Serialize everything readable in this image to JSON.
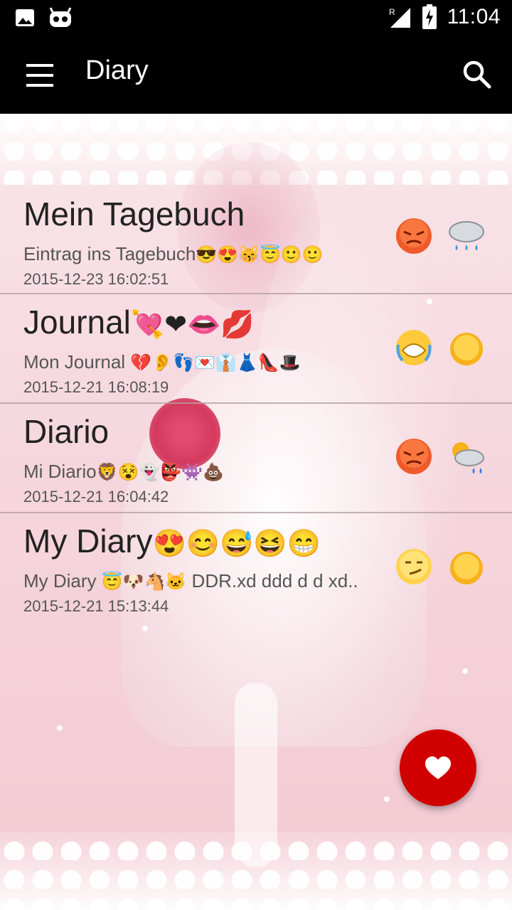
{
  "status_bar": {
    "time": "11:04",
    "icons": [
      "image-icon",
      "cyanogen-icon",
      "roaming-signal-icon",
      "battery-charging-icon"
    ]
  },
  "app_bar": {
    "title": "Diary",
    "menu_icon": "hamburger-menu-icon",
    "search_icon": "search-icon"
  },
  "entries": [
    {
      "title": "Mein Tagebuch",
      "subtitle": "Eintrag ins Tagebuch",
      "date": "2015-12-23 16:02:51",
      "title_emoji": "",
      "subtitle_emoji": "😎😍😽😇🙂🙂",
      "mood_icon": "angry-face-icon",
      "weather_icon": "rain-cloud-icon"
    },
    {
      "title": "Journal",
      "subtitle": "Mon Journal ",
      "date": "2015-12-21 16:08:19",
      "title_emoji": "💘❤👄💋",
      "subtitle_emoji": "💔👂👣💌👔👗👠🎩",
      "mood_icon": "crying-face-icon",
      "weather_icon": "sun-icon"
    },
    {
      "title": "Diario",
      "subtitle": "Mi Diario",
      "date": "2015-12-21 16:04:42",
      "title_emoji": "",
      "subtitle_emoji": "🦁😵👻👺👾💩",
      "mood_icon": "angry-face-icon",
      "weather_icon": "sun-behind-rain-cloud-icon"
    },
    {
      "title": "My Diary",
      "subtitle": "My Diary ",
      "subtitle_tail": " DDR.xd ddd d d xd..",
      "date": "2015-12-21 15:13:44",
      "title_emoji": "😍😊😅😆😁",
      "subtitle_emoji": "😇🐶🐴🐱",
      "mood_icon": "smirking-face-icon",
      "weather_icon": "sun-icon"
    }
  ],
  "fab": {
    "icon": "heart-icon"
  },
  "colors": {
    "bar_background": "#000000",
    "fab_red": "#d10000",
    "title_text": "#222222",
    "secondary_text": "#555555"
  }
}
